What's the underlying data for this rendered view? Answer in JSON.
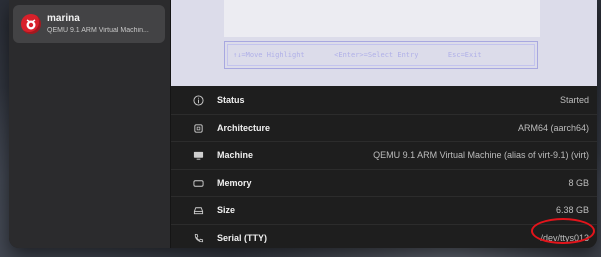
{
  "sidebar": {
    "vm": {
      "name": "marina",
      "subtitle": "QEMU 9.1 ARM Virtual Machin..."
    }
  },
  "display": {
    "help_text": "↑↓=Move Highlight       <Enter>=Select Entry       Esc=Exit"
  },
  "details": [
    {
      "icon": "info-icon",
      "label": "Status",
      "value": "Started"
    },
    {
      "icon": "chip-icon",
      "label": "Architecture",
      "value": "ARM64 (aarch64)"
    },
    {
      "icon": "monitor-icon",
      "label": "Machine",
      "value": "QEMU 9.1 ARM Virtual Machine (alias of virt-9.1) (virt)"
    },
    {
      "icon": "memory-icon",
      "label": "Memory",
      "value": "8 GB"
    },
    {
      "icon": "drive-icon",
      "label": "Size",
      "value": "6.38 GB"
    },
    {
      "icon": "phone-icon",
      "label": "Serial (TTY)",
      "value": "/dev/ttys013"
    }
  ],
  "colors": {
    "annotation": "#e3141b",
    "vm_icon": "#d8202a"
  }
}
